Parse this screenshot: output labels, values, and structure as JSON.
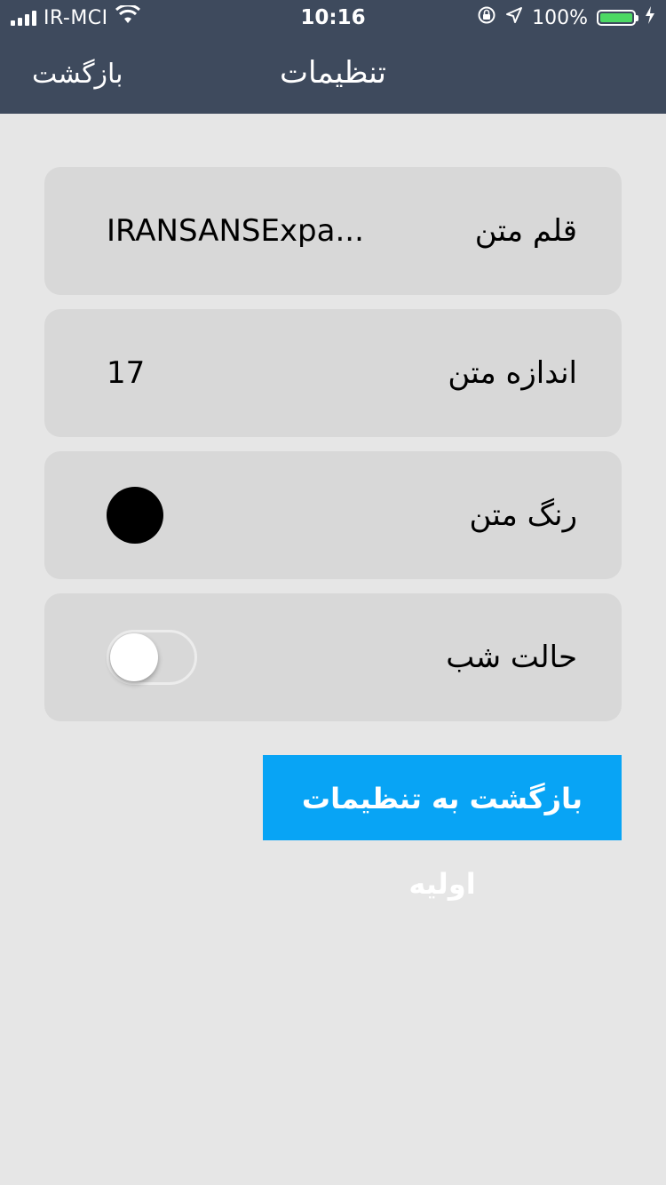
{
  "status_bar": {
    "carrier": "IR-MCI",
    "time": "10:16",
    "battery": "100%",
    "battery_level": 1.0,
    "icons": [
      "signal-icon",
      "wifi-icon",
      "rotation-lock-icon",
      "location-icon",
      "battery-icon",
      "charging-icon"
    ]
  },
  "nav": {
    "title": "تنظیمات",
    "back_label": "بازگشت"
  },
  "settings": {
    "font": {
      "label": "قلم متن",
      "value": "IRANSANSExpa..."
    },
    "size": {
      "label": "اندازه متن",
      "value": "17"
    },
    "color": {
      "label": "رنگ متن",
      "value_color": "#000000"
    },
    "night_mode": {
      "label": "حالت شب",
      "enabled": false
    }
  },
  "reset_button": {
    "label": "بازگشت به تنظیمات اولیه"
  },
  "colors": {
    "nav_background": "#3e4a5d",
    "page_background": "#e6e6e6",
    "row_background": "#d8d8d8",
    "accent_button": "#08a4f5",
    "battery_fill": "#4cd964"
  }
}
